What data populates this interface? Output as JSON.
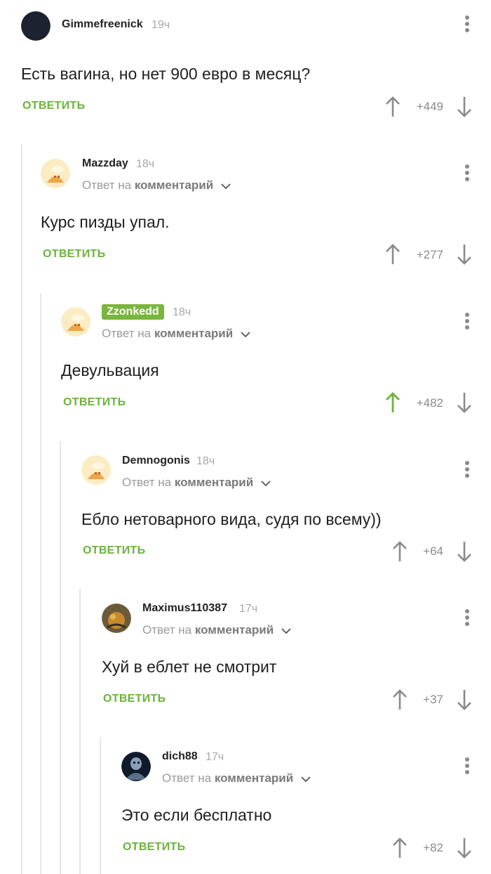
{
  "comments": [
    {
      "user": "Gimmefreenick",
      "time": "19ч",
      "text": "Есть вагина, но нет 900 евро в месяц?",
      "reply": "ОТВЕТИТЬ",
      "score": "+449",
      "vote": "none"
    },
    {
      "user": "Mazzday",
      "time": "18ч",
      "reply_prefix": "Ответ на",
      "reply_target": "комментарий",
      "text": "Курс пизды упал.",
      "reply": "ОТВЕТИТЬ",
      "score": "+277",
      "vote": "none"
    },
    {
      "user": "Zzonkedd",
      "time": "18ч",
      "reply_prefix": "Ответ на",
      "reply_target": "комментарий",
      "text": "Девульвация",
      "reply": "ОТВЕТИТЬ",
      "score": "+482",
      "vote": "up"
    },
    {
      "user": "Demnogonis",
      "time": "18ч",
      "reply_prefix": "Ответ на",
      "reply_target": "комментарий",
      "text": "Ебло нетоварного вида, судя по всему))",
      "reply": "ОТВЕТИТЬ",
      "score": "+64",
      "vote": "none"
    },
    {
      "user": "Maximus110387",
      "time": "17ч",
      "reply_prefix": "Ответ на",
      "reply_target": "комментарий",
      "text": "Хуй в еблет не смотрит",
      "reply": "ОТВЕТИТЬ",
      "score": "+37",
      "vote": "none"
    },
    {
      "user": "dich88",
      "time": "17ч",
      "reply_prefix": "Ответ на",
      "reply_target": "комментарий",
      "text": "Это если бесплатно",
      "reply": "ОТВЕТИТЬ",
      "score": "+82",
      "vote": "none"
    }
  ],
  "colors": {
    "accent": "#6bb33c",
    "badge": "#7ab53d",
    "upvoted": "#6bb33c",
    "muted": "#8a8a8a"
  },
  "icons": [
    "more-vertical-icon",
    "arrow-up-icon",
    "arrow-down-icon",
    "chevron-down-icon"
  ]
}
